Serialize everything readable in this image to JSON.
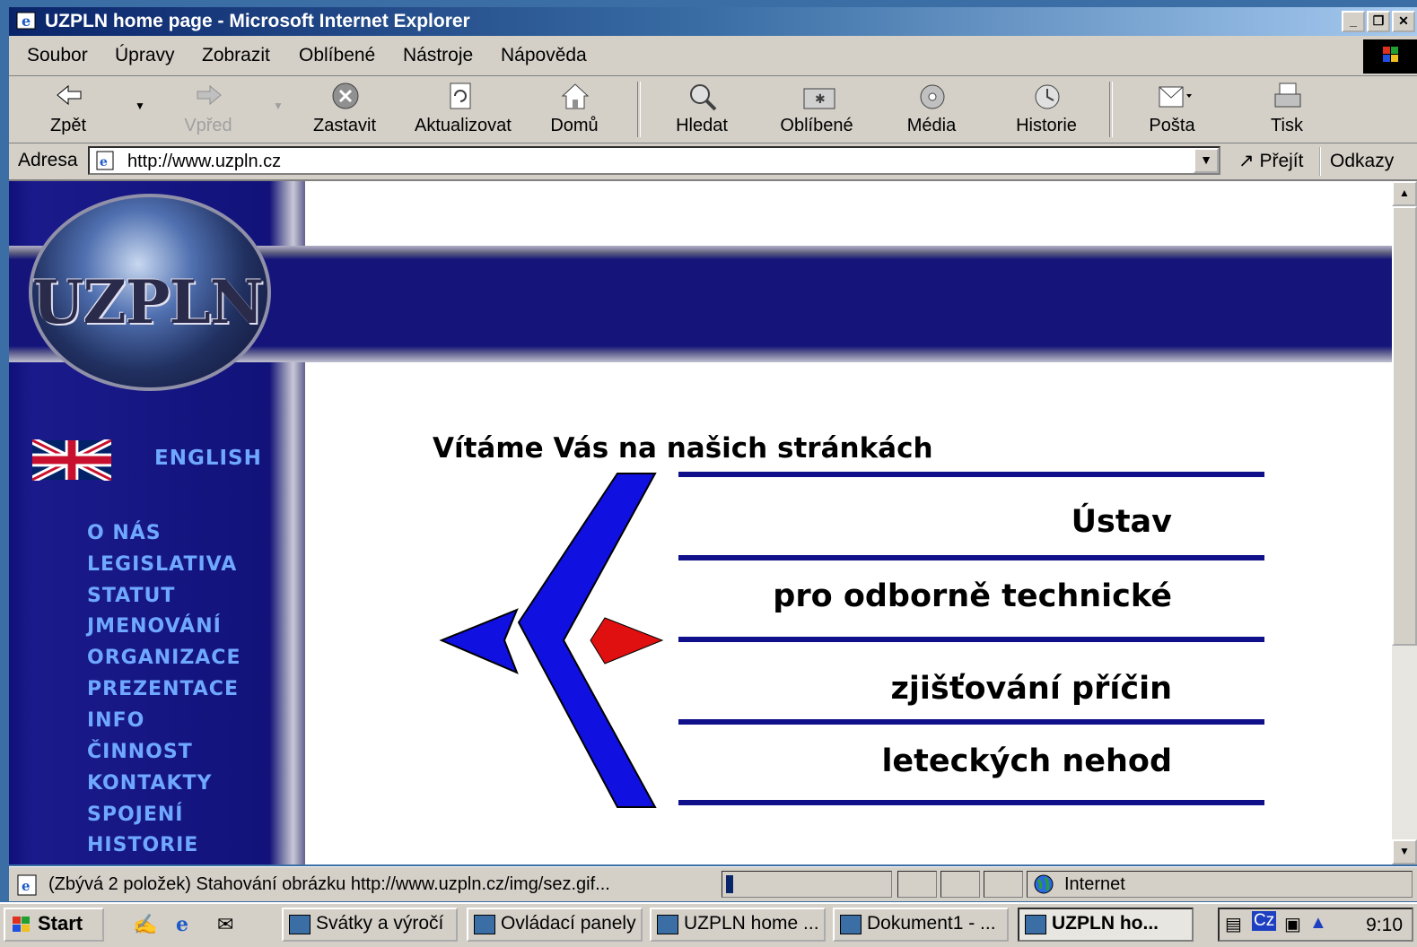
{
  "window": {
    "title": "UZPLN home page - Microsoft Internet Explorer"
  },
  "menu": [
    "Soubor",
    "Úpravy",
    "Zobrazit",
    "Oblíbené",
    "Nástroje",
    "Nápověda"
  ],
  "toolbar": {
    "back": "Zpět",
    "forward": "Vpřed",
    "stop": "Zastavit",
    "refresh": "Aktualizovat",
    "home": "Domů",
    "search": "Hledat",
    "favorites": "Oblíbené",
    "media": "Média",
    "history": "Historie",
    "mail": "Pošta",
    "print": "Tisk"
  },
  "address": {
    "label": "Adresa",
    "url": "http://www.uzpln.cz",
    "go": "Přejít",
    "links": "Odkazy"
  },
  "page": {
    "logo": "UZPLN",
    "english": "ENGLISH",
    "nav": [
      "O NÁS",
      "LEGISLATIVA",
      "STATUT",
      "JMENOVÁNÍ",
      "ORGANIZACE",
      "PREZENTACE",
      "INFO",
      "ČINNOST",
      "KONTAKTY",
      "SPOJENÍ",
      "HISTORIE"
    ],
    "welcome": "Vítáme Vás na našich stránkách",
    "lines": [
      "Ústav",
      "pro odborně technické",
      "zjišťování příčin",
      "leteckých nehod"
    ],
    "colors": {
      "nav": "#6fa8ff",
      "banner": "#14147a",
      "arrow_blue": "#1010e0",
      "arrow_red": "#e01010"
    }
  },
  "status": {
    "text": "(Zbývá 2 položek) Stahování obrázku http://www.uzpln.cz/img/sez.gif...",
    "zone": "Internet"
  },
  "taskbar": {
    "start": "Start",
    "buttons": [
      "Svátky a výročí",
      "Ovládací panely",
      "UZPLN home ...",
      "Dokument1 - ...",
      "UZPLN ho..."
    ],
    "tray_lang": "Cz",
    "clock": "9:10"
  }
}
